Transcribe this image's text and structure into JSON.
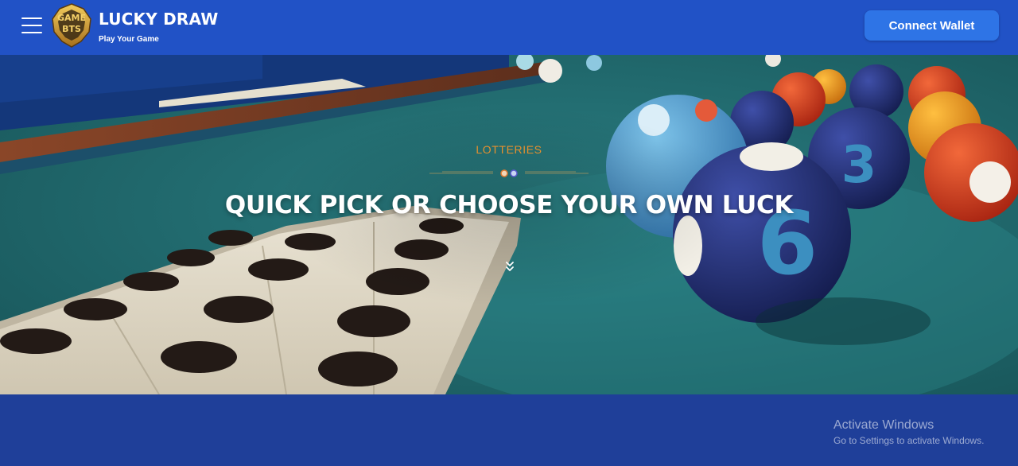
{
  "header": {
    "brand_title": "LUCKY DRAW",
    "brand_subtitle": "Play Your Game",
    "logo_text": [
      "GAME",
      "BTS"
    ],
    "connect_button": "Connect Wallet"
  },
  "hero": {
    "eyebrow": "LOTTERIES",
    "headline": "QUICK PICK OR CHOOSE YOUR OWN LUCK"
  },
  "watermark": {
    "title": "Activate Windows",
    "subtitle": "Go to Settings to activate Windows."
  },
  "colors": {
    "header_bg": "#2152c6",
    "page_bg": "#1f3f99",
    "button_bg": "#2e74e6",
    "eyebrow": "#e6902e",
    "felt": "#1f6a70"
  },
  "icons": [
    "menu-icon",
    "game-bts-logo",
    "chevron-double-down-icon"
  ]
}
